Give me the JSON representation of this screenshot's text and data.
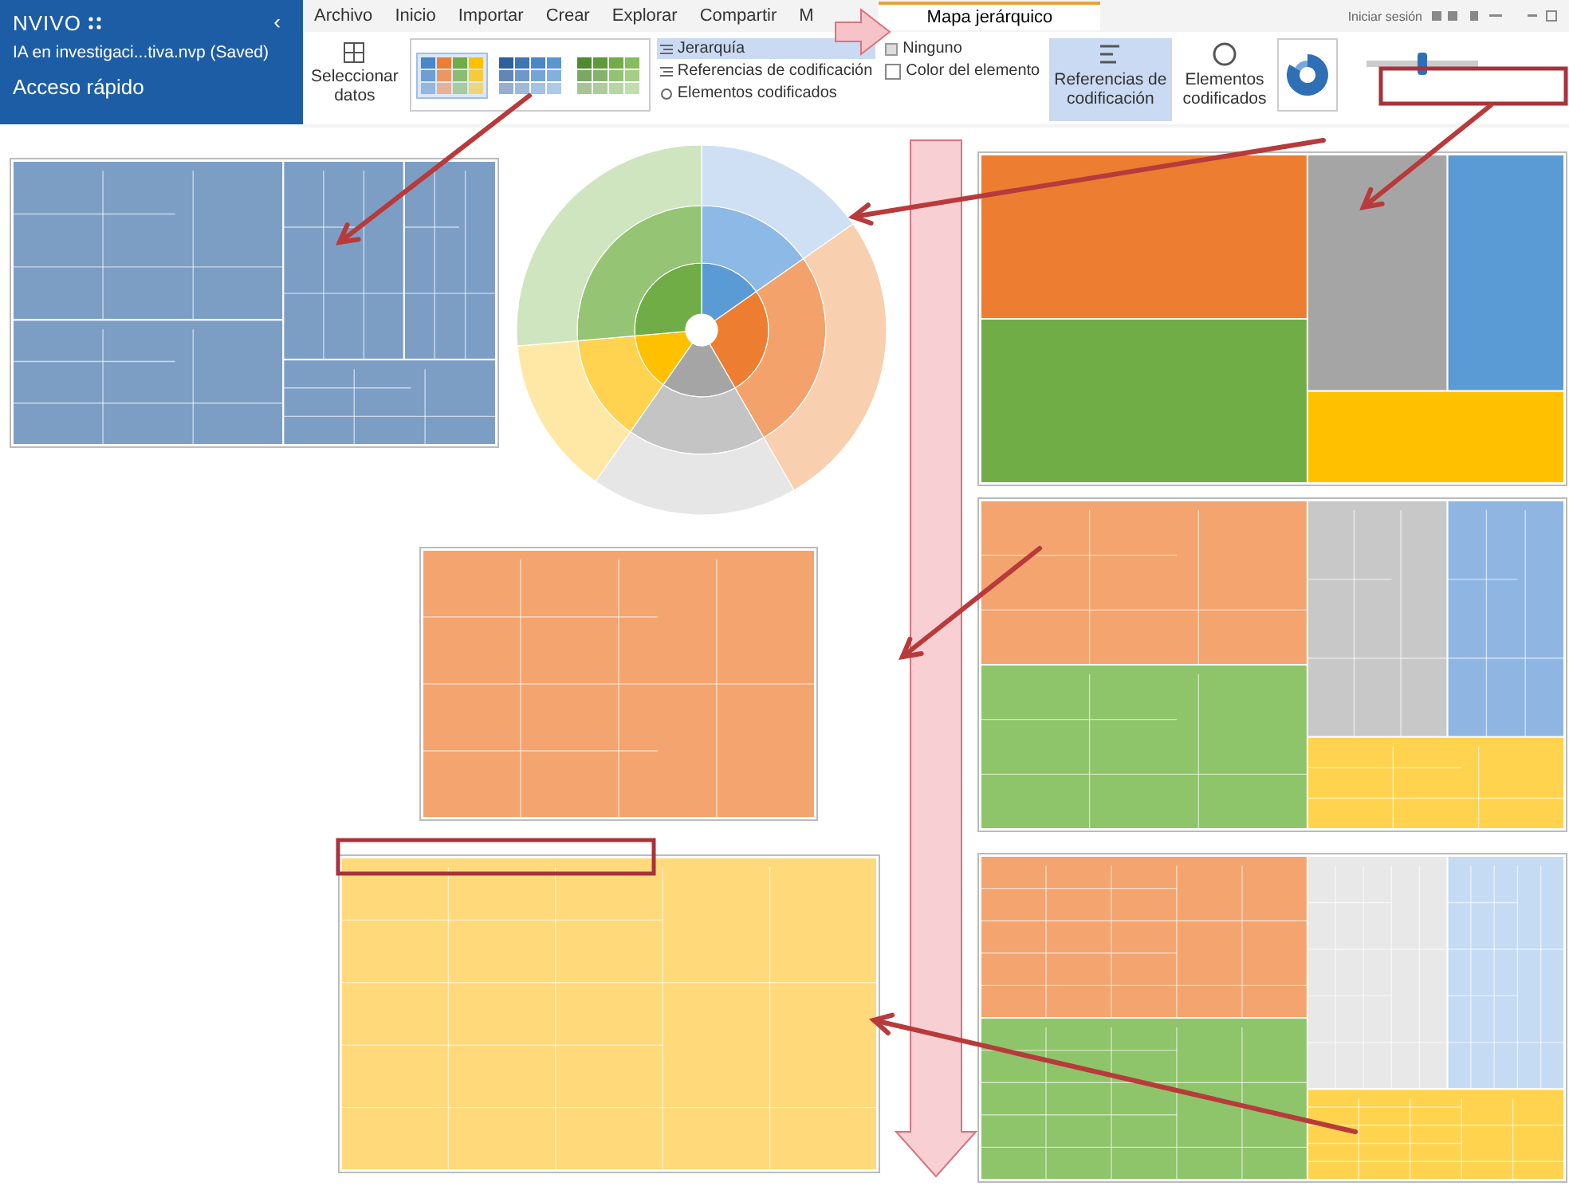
{
  "app": {
    "logo": "NVIVO",
    "collapse": "‹",
    "project": "IA en investigaci...tiva.nvp (Saved)",
    "section": "Acceso rápido"
  },
  "menu": [
    {
      "label": "Archivo"
    },
    {
      "label": "Inicio"
    },
    {
      "label": "Importar"
    },
    {
      "label": "Crear"
    },
    {
      "label": "Explorar"
    },
    {
      "label": "Compartir"
    },
    {
      "label": "M"
    }
  ],
  "context_tab": {
    "label": "Mapa jerárquico",
    "selected": true
  },
  "account": {
    "label": "Iniciar sesión"
  },
  "ribbon": {
    "select_data": "Seleccionar datos",
    "palettes": [
      {
        "selected": true
      },
      {
        "selected": false
      },
      {
        "selected": false
      }
    ],
    "modes": [
      {
        "label": "Jerarquía",
        "selected": true
      },
      {
        "label": "Referencias de codificación",
        "selected": false
      },
      {
        "label": "Elementos codificados",
        "selected": false
      }
    ],
    "none_option": {
      "label": "Ninguno"
    },
    "color_option": {
      "label": "Color del elemento",
      "checked": false
    },
    "measures": [
      {
        "label": "Referencias de codificación",
        "selected": true
      },
      {
        "label": "Elementos codificados",
        "selected": false
      }
    ],
    "zoom": {
      "level": 0.5
    }
  }
}
